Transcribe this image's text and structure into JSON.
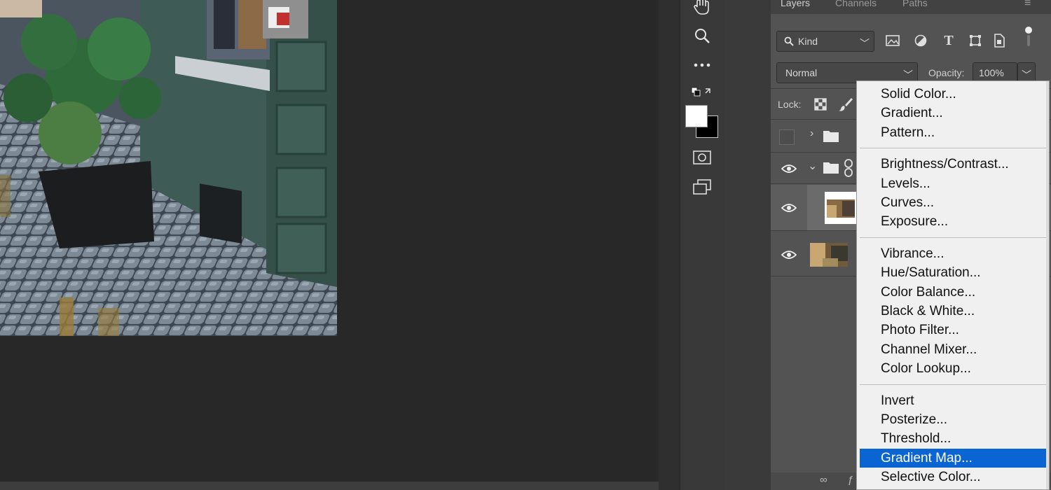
{
  "panel": {
    "tabs": [
      {
        "label": "Layers",
        "active": true
      },
      {
        "label": "Channels",
        "active": false
      },
      {
        "label": "Paths",
        "active": false
      }
    ],
    "filter_kind": "Kind",
    "blend_mode": "Normal",
    "opacity_label": "Opacity:",
    "opacity_value": "100%",
    "lock_label": "Lock:"
  },
  "menu": {
    "groups": [
      [
        "Solid Color...",
        "Gradient...",
        "Pattern..."
      ],
      [
        "Brightness/Contrast...",
        "Levels...",
        "Curves...",
        "Exposure..."
      ],
      [
        "Vibrance...",
        "Hue/Saturation...",
        "Color Balance...",
        "Black & White...",
        "Photo Filter...",
        "Channel Mixer...",
        "Color Lookup..."
      ],
      [
        "Invert",
        "Posterize...",
        "Threshold...",
        "Gradient Map...",
        "Selective Color..."
      ]
    ],
    "highlighted": "Gradient Map..."
  },
  "colors": {
    "canvas_bg": "#282828",
    "panel_bg": "#535353",
    "menu_bg": "#f0f0f0",
    "highlight": "#0a64d2"
  }
}
